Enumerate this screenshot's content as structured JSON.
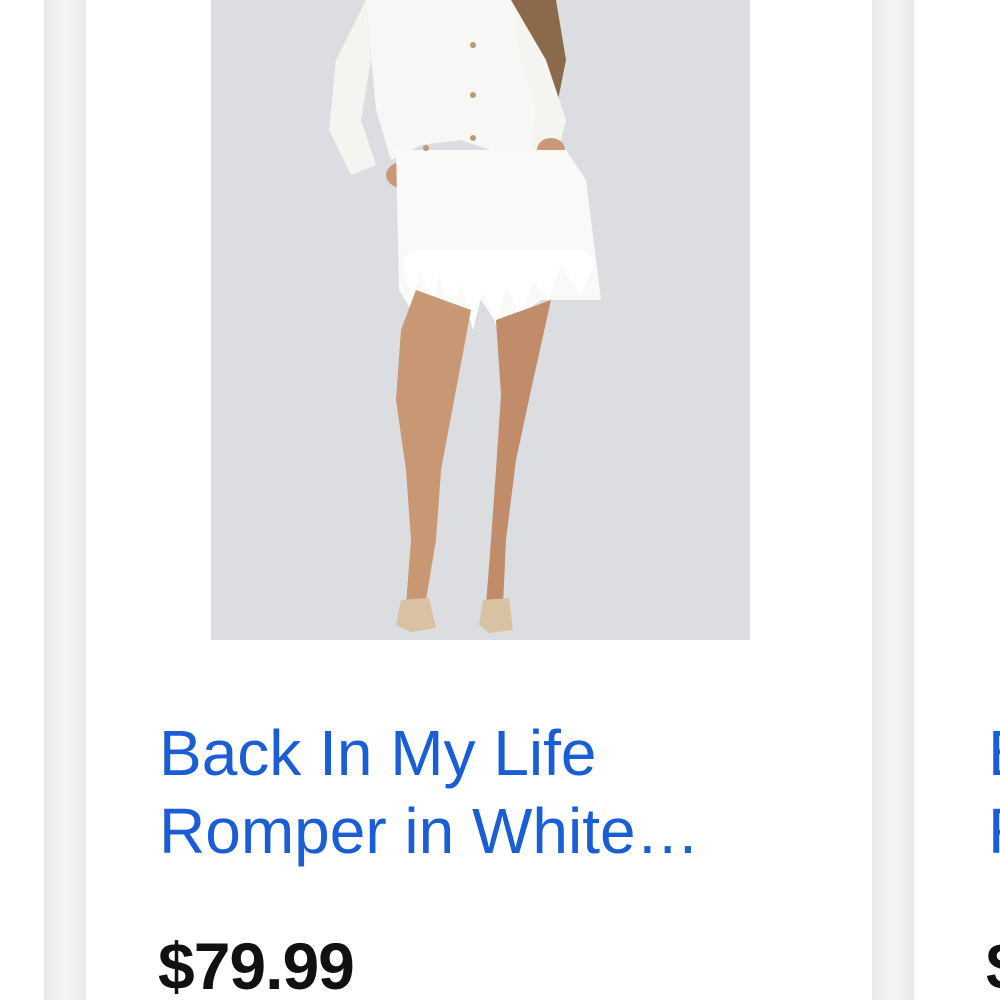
{
  "products": [
    {
      "title": "Back In My Life\nRomper in White…",
      "price": "$79.99",
      "image_alt": "model wearing white denim romper"
    },
    {
      "title": "B\nR",
      "price": "$"
    }
  ],
  "colors": {
    "link": "#1a5ed6",
    "price": "#111111",
    "gutter": "#efefef",
    "image_bg": "#dcdde0"
  }
}
